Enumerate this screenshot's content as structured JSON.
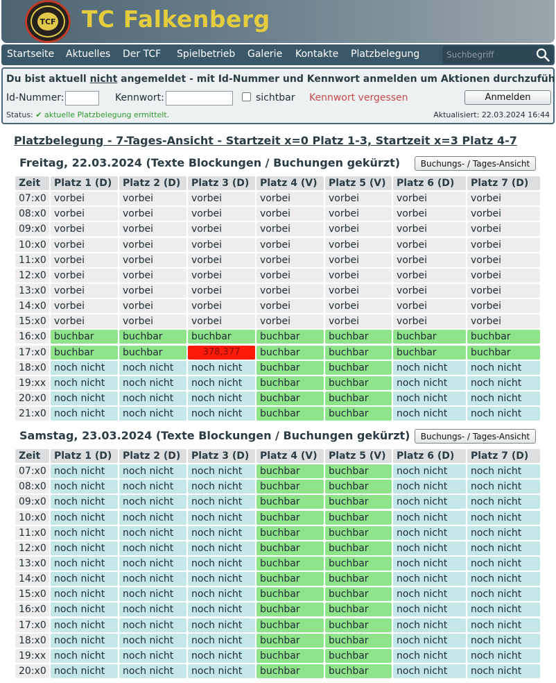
{
  "brand": {
    "title": "TC Falkenberg",
    "logo_text": "TCF",
    "logo_ring_text": "TENNISCLUB FALKENBERG"
  },
  "nav": {
    "items": [
      "Startseite",
      "Aktuelles",
      "Der TCF",
      "Spielbetrieb",
      "Galerie",
      "Kontakte",
      "Platzbelegung"
    ],
    "search_placeholder": "Suchbegriff"
  },
  "login": {
    "message_pre": "Du bist aktuell ",
    "message_emph": "nicht",
    "message_post": " angemeldet - mit Id-Nummer und Kennwort anmelden um Aktionen durchzuführen.",
    "id_label": "Id-Nummer:",
    "pw_label": "Kennwort:",
    "show_label": "sichtbar",
    "forgot_label": "Kennwort vergessen",
    "login_button": "Anmelden",
    "status_label": "Status:",
    "status_text": "✔ aktuelle Platzbelegung ermittelt.",
    "updated_text": "Aktualisiert: 22.03.2024 16:44"
  },
  "page_title": "Platzbelegung - 7-Tages-Ansicht - Startzeit x=0 Platz 1-3, Startzeit x=3 Platz 4-7",
  "columns": [
    "Zeit",
    "Platz 1 (D)",
    "Platz 2 (D)",
    "Platz 3 (D)",
    "Platz 4 (V)",
    "Platz 5 (V)",
    "Platz 6 (D)",
    "Platz 7 (D)"
  ],
  "status_labels": {
    "v": "vorbei",
    "b": "buchbar",
    "n": "noch nicht"
  },
  "colors": {
    "vorbei": "#ededed",
    "buchbar": "#8fe38a",
    "noch_nicht": "#c3e7e8",
    "booked": "#ff1a0a",
    "brand_yellow": "#e3cc3e",
    "nav": "#3a5867"
  },
  "days": [
    {
      "title": "Freitag, 22.03.2024 (Texte Blockungen / Buchungen gekürzt)",
      "button": "Buchungs- / Tages-Ansicht",
      "rows": [
        {
          "time": "07:x0",
          "cells": [
            "v",
            "v",
            "v",
            "v",
            "v",
            "v",
            "v"
          ]
        },
        {
          "time": "08:x0",
          "cells": [
            "v",
            "v",
            "v",
            "v",
            "v",
            "v",
            "v"
          ]
        },
        {
          "time": "09:x0",
          "cells": [
            "v",
            "v",
            "v",
            "v",
            "v",
            "v",
            "v"
          ]
        },
        {
          "time": "10:x0",
          "cells": [
            "v",
            "v",
            "v",
            "v",
            "v",
            "v",
            "v"
          ]
        },
        {
          "time": "11:x0",
          "cells": [
            "v",
            "v",
            "v",
            "v",
            "v",
            "v",
            "v"
          ]
        },
        {
          "time": "12:x0",
          "cells": [
            "v",
            "v",
            "v",
            "v",
            "v",
            "v",
            "v"
          ]
        },
        {
          "time": "13:x0",
          "cells": [
            "v",
            "v",
            "v",
            "v",
            "v",
            "v",
            "v"
          ]
        },
        {
          "time": "14:x0",
          "cells": [
            "v",
            "v",
            "v",
            "v",
            "v",
            "v",
            "v"
          ]
        },
        {
          "time": "15:x0",
          "cells": [
            "v",
            "v",
            "v",
            "v",
            "v",
            "v",
            "v"
          ]
        },
        {
          "time": "16:x0",
          "cells": [
            "b",
            "b",
            "b",
            "b",
            "b",
            "b",
            "b"
          ]
        },
        {
          "time": "17:x0",
          "cells": [
            "b",
            "b",
            "378,377",
            "b",
            "b",
            "b",
            "b"
          ]
        },
        {
          "time": "18:x0",
          "cells": [
            "n",
            "n",
            "n",
            "b",
            "b",
            "n",
            "n"
          ]
        },
        {
          "time": "19:xx",
          "cells": [
            "n",
            "n",
            "n",
            "b",
            "b",
            "n",
            "n"
          ]
        },
        {
          "time": "20:x0",
          "cells": [
            "n",
            "n",
            "n",
            "b",
            "b",
            "n",
            "n"
          ]
        },
        {
          "time": "21:x0",
          "cells": [
            "n",
            "n",
            "n",
            "b",
            "b",
            "n",
            "n"
          ]
        }
      ]
    },
    {
      "title": "Samstag, 23.03.2024 (Texte Blockungen / Buchungen gekürzt)",
      "button": "Buchungs- / Tages-Ansicht",
      "rows": [
        {
          "time": "07:x0",
          "cells": [
            "n",
            "n",
            "n",
            "b",
            "b",
            "n",
            "n"
          ]
        },
        {
          "time": "08:x0",
          "cells": [
            "n",
            "n",
            "n",
            "b",
            "b",
            "n",
            "n"
          ]
        },
        {
          "time": "09:x0",
          "cells": [
            "n",
            "n",
            "n",
            "b",
            "b",
            "n",
            "n"
          ]
        },
        {
          "time": "10:x0",
          "cells": [
            "n",
            "n",
            "n",
            "b",
            "b",
            "n",
            "n"
          ]
        },
        {
          "time": "11:x0",
          "cells": [
            "n",
            "n",
            "n",
            "b",
            "b",
            "n",
            "n"
          ]
        },
        {
          "time": "12:x0",
          "cells": [
            "n",
            "n",
            "n",
            "b",
            "b",
            "n",
            "n"
          ]
        },
        {
          "time": "13:x0",
          "cells": [
            "n",
            "n",
            "n",
            "b",
            "b",
            "n",
            "n"
          ]
        },
        {
          "time": "14:x0",
          "cells": [
            "n",
            "n",
            "n",
            "b",
            "b",
            "n",
            "n"
          ]
        },
        {
          "time": "15:x0",
          "cells": [
            "n",
            "n",
            "n",
            "b",
            "b",
            "n",
            "n"
          ]
        },
        {
          "time": "16:x0",
          "cells": [
            "n",
            "n",
            "n",
            "b",
            "b",
            "n",
            "n"
          ]
        },
        {
          "time": "17:x0",
          "cells": [
            "n",
            "n",
            "n",
            "b",
            "b",
            "n",
            "n"
          ]
        },
        {
          "time": "18:x0",
          "cells": [
            "n",
            "n",
            "n",
            "b",
            "b",
            "n",
            "n"
          ]
        },
        {
          "time": "19:xx",
          "cells": [
            "n",
            "n",
            "n",
            "b",
            "b",
            "n",
            "n"
          ]
        },
        {
          "time": "20:x0",
          "cells": [
            "n",
            "n",
            "n",
            "b",
            "b",
            "n",
            "n"
          ]
        }
      ]
    }
  ]
}
